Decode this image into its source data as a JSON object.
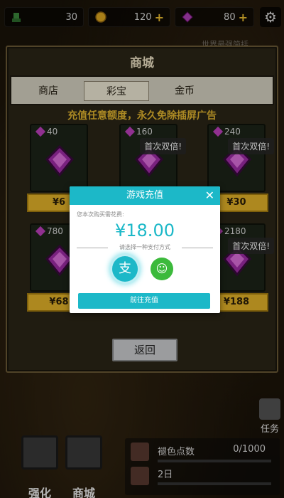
{
  "resources": [
    {
      "icon": "green-character-icon",
      "value": "30"
    },
    {
      "icon": "gold-coin-icon",
      "value": "120",
      "plus": "+"
    },
    {
      "icon": "purple-gem-icon",
      "value": "80",
      "plus": "+"
    }
  ],
  "settings_icon": "gear-icon",
  "behind_text": "世界最强简括",
  "shop": {
    "title": "商城",
    "tabs": [
      "商店",
      "彩宝",
      "金币"
    ],
    "active_tab": "彩宝",
    "notice": "充值任意额度，永久免除插屏广告",
    "items": [
      {
        "amount": "40",
        "price": "¥6",
        "badge": ""
      },
      {
        "amount": "160",
        "price": "¥",
        "badge": "首次双倍!"
      },
      {
        "amount": "240",
        "price": "¥30",
        "badge": "首次双倍!"
      },
      {
        "amount": "780",
        "price": "¥68",
        "badge": ""
      },
      {
        "amount": "",
        "price": "",
        "badge": ""
      },
      {
        "amount": "2180",
        "price": "¥188",
        "badge": "首次双倍!"
      }
    ],
    "back_label": "返回"
  },
  "bottom": {
    "nav": [
      "强化",
      "商城"
    ],
    "task_label": "任务",
    "progress": [
      {
        "label": "褪色点数",
        "value": "0/1000",
        "fill": 0
      },
      {
        "label": "2日",
        "fill": 0
      }
    ]
  },
  "modal": {
    "title": "游戏充值",
    "close": "✕",
    "hint": "您本次购买需花费:",
    "amount": "¥18.00",
    "choose": "请选择一种支付方式",
    "alipay_glyph": "支",
    "wechat_glyph": "☺",
    "go_label": "前往充值"
  },
  "colors": {
    "accent": "#1cb8c8",
    "gold": "#e7b62a",
    "gem": "#c040c0"
  }
}
